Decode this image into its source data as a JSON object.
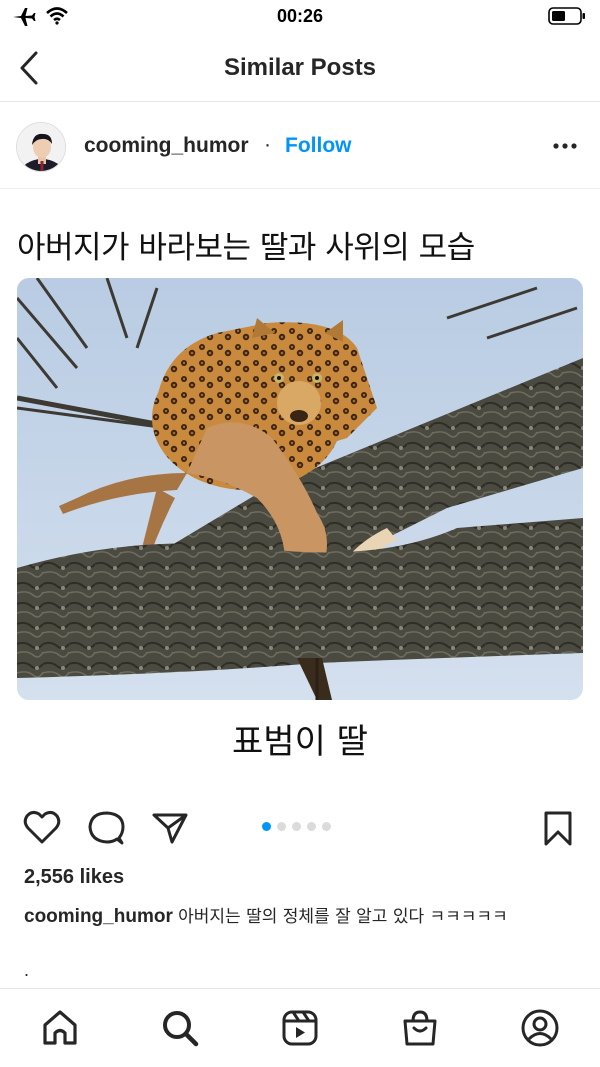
{
  "status": {
    "time": "00:26"
  },
  "nav": {
    "title": "Similar Posts"
  },
  "post": {
    "username": "cooming_humor",
    "separator": "·",
    "follow_label": "Follow",
    "media": {
      "headline": "아버지가 바라보는 딸과 사위의 모습",
      "bottom_caption": "표범이 딸",
      "carousel_count": 5,
      "carousel_active": 0
    },
    "likes_label": "2,556 likes",
    "caption_user": "cooming_humor",
    "caption_text": "아버지는 딸의 정체를 잘 알고 있다 ㅋㅋㅋㅋㅋ",
    "caption_more": "."
  },
  "icons": {
    "status": [
      "airplane-icon",
      "wifi-icon",
      "battery-icon"
    ],
    "actions": [
      "heart-icon",
      "comment-icon",
      "share-icon",
      "bookmark-icon"
    ],
    "tabs": [
      "home-icon",
      "search-icon",
      "reels-icon",
      "shop-icon",
      "profile-icon"
    ]
  },
  "colors": {
    "accent": "#0095f6",
    "text": "#262626",
    "divider": "#e6e6e6"
  }
}
